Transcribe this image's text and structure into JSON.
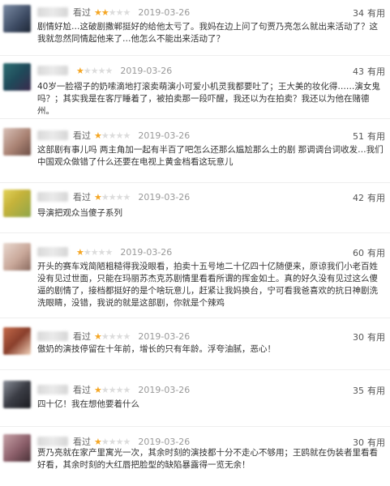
{
  "useful_label": "有用",
  "star_colors": {
    "on": "#f5a623",
    "off": "#dcdcdc"
  },
  "reviews": [
    {
      "status": "看过",
      "rating": 2,
      "date": "2019-03-26",
      "useful_count": "34",
      "text": "剧情好尬…这破剧撒郸挺好的给他太亏了。我妈在边上问了句贾乃亮怎么就出来活动了？这我就忽然同情起他来了…他怎么不能出来活动了？"
    },
    {
      "status": "",
      "rating": 1,
      "date": "2019-03-26",
      "useful_count": "43",
      "text": "40岁一脸褶子的奶嗦滴地打滚卖萌演小可爱小机灵我都要吐了；王大美的妆化得……演女鬼吗？；其实我是在客厅睡着了，被拍卖那一段吓醒，我还以为在拍卖？我还以为他在赌德州。"
    },
    {
      "status": "看过",
      "rating": 1,
      "date": "2019-03-26",
      "useful_count": "51",
      "text": "这部剧有事儿吗 两主角加一起有半百了吧怎么还那么尴尬那么土的剧 那调调台词收发…我们中国观众做错了什么还要在电视上黄金档看这玩意儿"
    },
    {
      "status": "看过",
      "rating": 1,
      "date": "2019-03-26",
      "useful_count": "42",
      "text": "导演把观众当傻子系列"
    },
    {
      "status": "",
      "rating": 1,
      "date": "2019-03-26",
      "useful_count": "60",
      "text": "开头的赛车戏简陋粗糙得我没眼看，拍卖十五号地二十亿四十亿随便来，原谅我们小老百姓没有见过世面，只能在玛丽苏杰克苏剧情里看看所谓的挥金如土。真的好久没有见过这么傻逼的剧情了，接档都挺好的是个啥玩意儿，赶紧让我妈换台，宁可看我爸喜欢的抗日神剧洗洗眼睛，没错，我说的就是这部剧，你就是个辣鸡"
    },
    {
      "status": "看过",
      "rating": 1,
      "date": "2019-03-26",
      "useful_count": "30",
      "text": "傲奶的演技停留在十年前，增长的只有年龄。浮夸油腻，恶心！"
    },
    {
      "status": "看过",
      "rating": 1,
      "date": "2019-03-26",
      "useful_count": "35",
      "text": "四十亿！我在想他要着什么"
    },
    {
      "status": "看过",
      "rating": 1,
      "date": "2019-03-26",
      "useful_count": "30",
      "text": "贾乃亮就在家产里寓光一次，其余时刻的演技都十分不走心不够用；王鸥就在伪装者里看看好看，其余时刻的大红唇把脸型的缺陷暴露得一览无余！"
    }
  ]
}
